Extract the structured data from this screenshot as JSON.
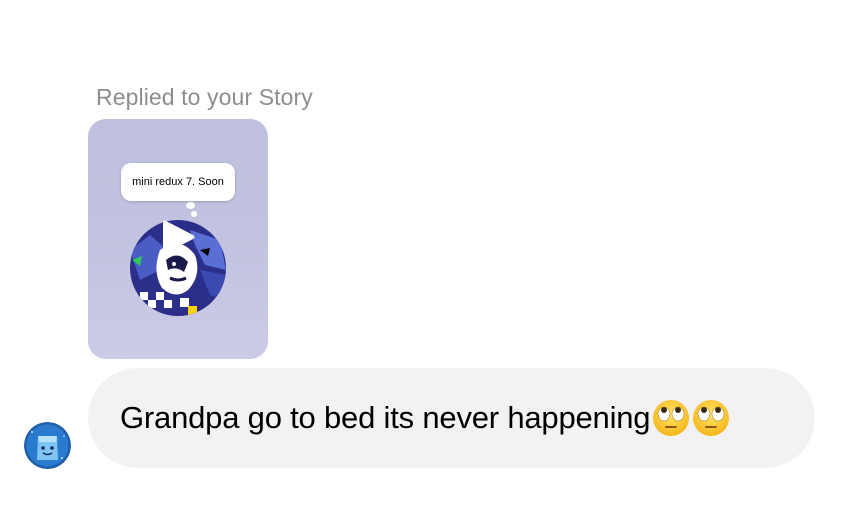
{
  "thread": {
    "reply_label": "Replied to your Story",
    "story": {
      "note_text": "mini redux 7. Soon",
      "media_type": "video",
      "background_color": "#c2c3e0"
    },
    "message": {
      "text": "Grandpa go to bed its never happening",
      "emojis": [
        "face-with-rolling-eyes",
        "face-with-rolling-eyes"
      ],
      "bubble_color": "#f2f2f2"
    },
    "sender": {
      "avatar_icon": "blue-character-avatar"
    }
  }
}
